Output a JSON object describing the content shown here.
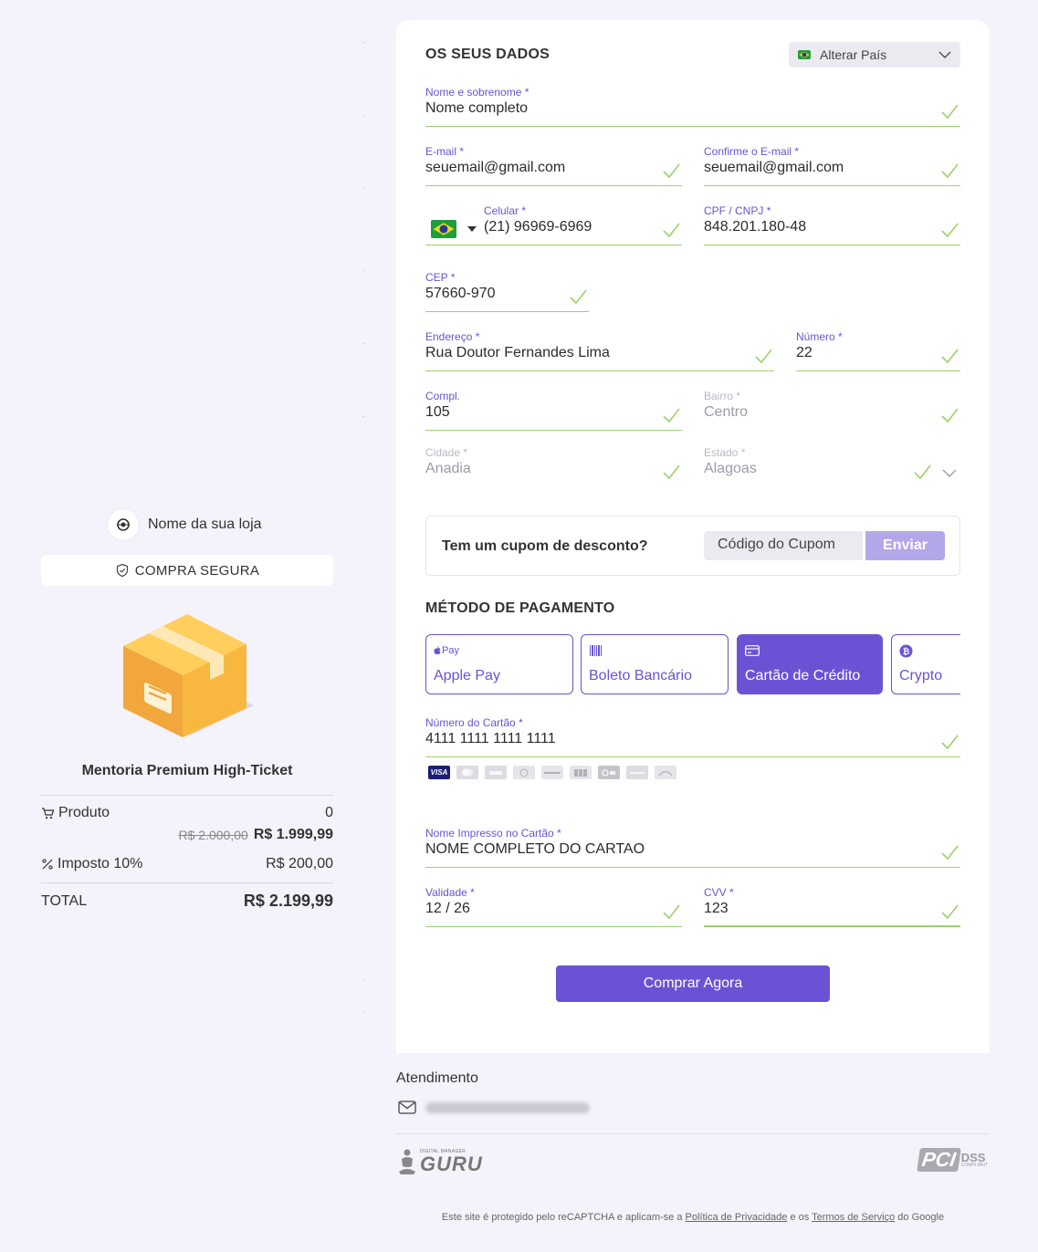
{
  "store": {
    "name": "Nome da sua loja",
    "secure_label": "COMPRA SEGURA"
  },
  "product": {
    "name": "Mentoria Premium High-Ticket",
    "row_label": "Produto",
    "quantity": "0",
    "old_price": "R$ 2.000,00",
    "price": "R$ 1.999,99",
    "tax_label": "Imposto 10%",
    "tax_value": "R$ 200,00",
    "total_label": "TOTAL",
    "total_value": "R$ 2.199,99"
  },
  "form": {
    "title": "OS SEUS DADOS",
    "country_button": "Alterar País",
    "fields": {
      "name": {
        "label": "Nome e sobrenome",
        "value": "Nome completo"
      },
      "email": {
        "label": "E-mail",
        "value": "seuemail@gmail.com"
      },
      "email_confirm": {
        "label": "Confirme o E-mail",
        "value": "seuemail@gmail.com"
      },
      "phone": {
        "label": "Celular",
        "value": "(21) 96969-6969"
      },
      "cpf": {
        "label": "CPF / CNPJ",
        "value": "848.201.180-48"
      },
      "cep": {
        "label": "CEP",
        "value": "57660-970"
      },
      "address": {
        "label": "Endereço",
        "value": "Rua Doutor Fernandes Lima"
      },
      "number": {
        "label": "Número",
        "value": "22"
      },
      "compl": {
        "label": "Compl.",
        "value": "105"
      },
      "bairro": {
        "label": "Bairro",
        "value": "Centro"
      },
      "cidade": {
        "label": "Cidade",
        "value": "Anadia"
      },
      "estado": {
        "label": "Estado",
        "value": "Alagoas"
      }
    },
    "required_mark": "*"
  },
  "coupon": {
    "question": "Tem um cupom de desconto?",
    "placeholder": "Código do Cupom",
    "button": "Enviar"
  },
  "payment": {
    "title": "MÉTODO DE PAGAMENTO",
    "apple_pay_badge": "Pay",
    "methods": [
      {
        "label": "Apple Pay",
        "icon": "apple-pay-icon"
      },
      {
        "label": "Boleto Bancário",
        "icon": "barcode-icon"
      },
      {
        "label": "Cartão de Crédito",
        "icon": "credit-card-icon"
      },
      {
        "label": "Crypto",
        "icon": "bitcoin-icon"
      }
    ],
    "selected": "Cartão de Crédito",
    "card_number": {
      "label": "Número do Cartão",
      "value": "4111 1111 1111 1111"
    },
    "card_brands": [
      "VISA",
      "mastercard",
      "amex",
      "diners",
      "discover",
      "jcb",
      "elo",
      "hipercard",
      "aura"
    ],
    "card_name": {
      "label": "Nome Impresso no Cartão",
      "value": "NOME COMPLETO DO CARTAO"
    },
    "validity": {
      "label": "Validade",
      "value": "12 / 26"
    },
    "cvv": {
      "label": "CVV",
      "value": "123"
    },
    "buy_button": "Comprar Agora"
  },
  "footer": {
    "support_title": "Atendimento",
    "guru_small": "DIGITAL MANAGER",
    "guru_big": "GURU",
    "pci_main": "PCI",
    "pci_dss": "DSS",
    "pci_compliant": "COMPLIANT",
    "recaptcha_prefix": "Este site é protegido pelo reCAPTCHA e aplicam-se a",
    "privacy_link": "Política de Privacidade",
    "and": "e os",
    "terms_link": "Termos de Serviço",
    "suffix": "do Google"
  },
  "colors": {
    "accent": "#6b52d4",
    "valid": "#9bd36a",
    "page_bg": "#f4f2fa",
    "box": "#f6b93b"
  }
}
